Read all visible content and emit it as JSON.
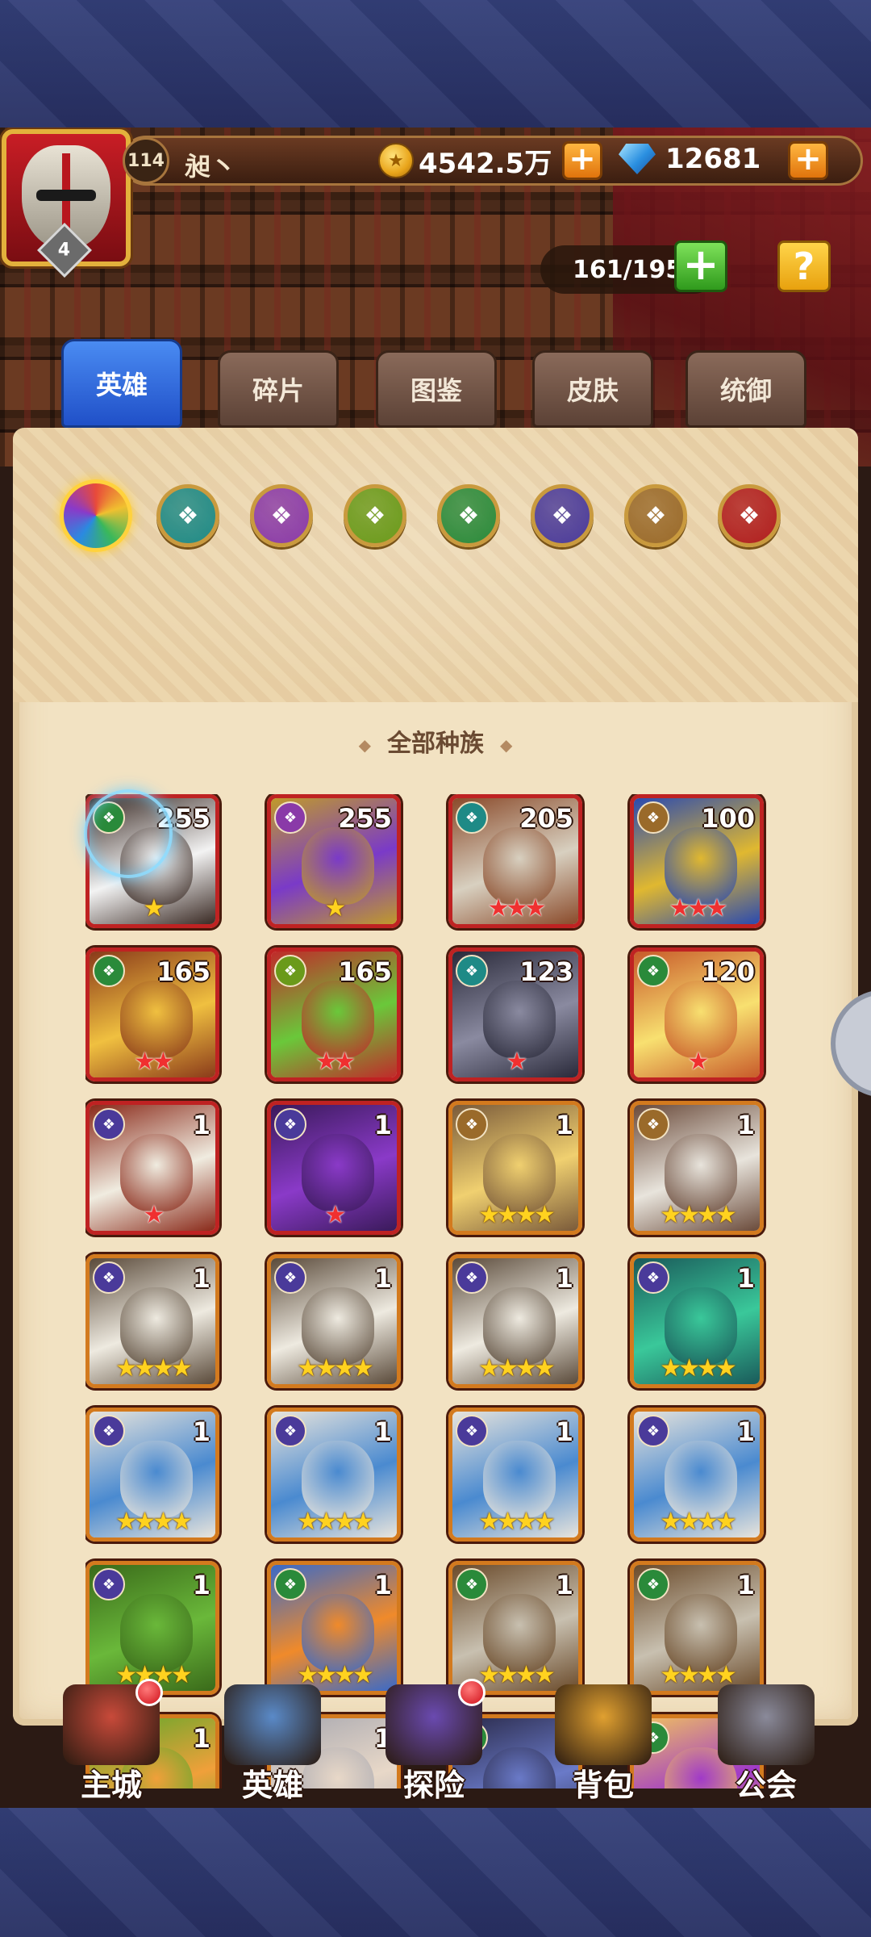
{
  "player": {
    "level": "114",
    "name": "昶丶",
    "vip": "4"
  },
  "currency": {
    "gold": "4542.5万",
    "gems": "12681"
  },
  "hero_capacity": "161/195",
  "buttons": {
    "plus": "+",
    "help": "?"
  },
  "tabs": [
    {
      "label": "英雄",
      "active": true
    },
    {
      "label": "碎片",
      "active": false
    },
    {
      "label": "图鉴",
      "active": false
    },
    {
      "label": "皮肤",
      "active": false
    },
    {
      "label": "统御",
      "active": false
    }
  ],
  "races": [
    {
      "name": "all",
      "icon": "rainbow-swirl-icon",
      "color": "#e84a3a",
      "selected": true
    },
    {
      "name": "sea",
      "icon": "trident-icon",
      "color": "#1e8a86"
    },
    {
      "name": "mystic",
      "icon": "violet-eye-icon",
      "color": "#8a3aa8"
    },
    {
      "name": "forest-eye",
      "icon": "green-eye-icon",
      "color": "#6a9a1a"
    },
    {
      "name": "nature",
      "icon": "leaf-icon",
      "color": "#2a8a3a"
    },
    {
      "name": "undead",
      "icon": "skull-wings-icon",
      "color": "#4a3a9a"
    },
    {
      "name": "light",
      "icon": "sun-wheel-icon",
      "color": "#9a6a2a"
    },
    {
      "name": "dark",
      "icon": "demon-icon",
      "color": "#b01e1e"
    }
  ],
  "race_filter_title": "全部种族",
  "heroes": [
    {
      "level": "255",
      "stars": 1,
      "star_color": "gold",
      "frame": "red",
      "race_color": "#2a8a3a",
      "palette": [
        "#f3f3f3",
        "#3a2a24"
      ]
    },
    {
      "level": "255",
      "stars": 1,
      "star_color": "gold",
      "frame": "red",
      "race_color": "#8a3aa8",
      "palette": [
        "#7a3ac8",
        "#c09a2a"
      ]
    },
    {
      "level": "205",
      "stars": 3,
      "star_color": "red",
      "frame": "red",
      "race_color": "#1e8a86",
      "palette": [
        "#d8d0c0",
        "#8a4a2a"
      ]
    },
    {
      "level": "100",
      "stars": 3,
      "star_color": "red",
      "frame": "red",
      "race_color": "#9a6a2a",
      "palette": [
        "#e0b830",
        "#2a4ab0"
      ]
    },
    {
      "level": "165",
      "stars": 2,
      "star_color": "red",
      "frame": "red",
      "race_color": "#2a8a3a",
      "palette": [
        "#f0c040",
        "#8a3a1a"
      ]
    },
    {
      "level": "165",
      "stars": 2,
      "star_color": "red",
      "frame": "red",
      "race_color": "#6a9a1a",
      "palette": [
        "#6ac83a",
        "#c02a2a"
      ]
    },
    {
      "level": "123",
      "stars": 1,
      "star_color": "red",
      "frame": "red",
      "race_color": "#1e8a86",
      "palette": [
        "#8a8aa0",
        "#2a2a3a"
      ]
    },
    {
      "level": "120",
      "stars": 1,
      "star_color": "red",
      "frame": "red",
      "race_color": "#2a8a3a",
      "palette": [
        "#f8e070",
        "#c85a2a"
      ]
    },
    {
      "level": "1",
      "stars": 1,
      "star_color": "red",
      "frame": "red",
      "race_color": "#4a3a9a",
      "palette": [
        "#f0ece0",
        "#8a2a1a"
      ]
    },
    {
      "level": "1",
      "stars": 1,
      "star_color": "red",
      "frame": "red",
      "race_color": "#4a3a9a",
      "palette": [
        "#8a3ac8",
        "#3a1a5a"
      ]
    },
    {
      "level": "1",
      "stars": 4,
      "star_color": "gold",
      "frame": "orange",
      "race_color": "#9a6a2a",
      "palette": [
        "#f0d070",
        "#7a5a3a"
      ]
    },
    {
      "level": "1",
      "stars": 4,
      "star_color": "gold",
      "frame": "orange",
      "race_color": "#9a6a2a",
      "palette": [
        "#e8e4dc",
        "#6a4a3a"
      ]
    },
    {
      "level": "1",
      "stars": 4,
      "star_color": "gold",
      "frame": "orange",
      "race_color": "#4a3a9a",
      "palette": [
        "#eeeae0",
        "#5a4a3a"
      ]
    },
    {
      "level": "1",
      "stars": 4,
      "star_color": "gold",
      "frame": "orange",
      "race_color": "#4a3a9a",
      "palette": [
        "#eeeae0",
        "#5a4a3a"
      ]
    },
    {
      "level": "1",
      "stars": 4,
      "star_color": "gold",
      "frame": "orange",
      "race_color": "#4a3a9a",
      "palette": [
        "#eeeae0",
        "#5a4a3a"
      ]
    },
    {
      "level": "1",
      "stars": 4,
      "star_color": "gold",
      "frame": "orange",
      "race_color": "#4a3a9a",
      "palette": [
        "#3ac89a",
        "#1a5a5a"
      ]
    },
    {
      "level": "1",
      "stars": 4,
      "star_color": "gold",
      "frame": "orange",
      "race_color": "#4a3a9a",
      "palette": [
        "#4a8ad0",
        "#e8e4dc"
      ]
    },
    {
      "level": "1",
      "stars": 4,
      "star_color": "gold",
      "frame": "orange",
      "race_color": "#4a3a9a",
      "palette": [
        "#4a8ad0",
        "#e8e4dc"
      ]
    },
    {
      "level": "1",
      "stars": 4,
      "star_color": "gold",
      "frame": "orange",
      "race_color": "#4a3a9a",
      "palette": [
        "#4a8ad0",
        "#e8e4dc"
      ]
    },
    {
      "level": "1",
      "stars": 4,
      "star_color": "gold",
      "frame": "orange",
      "race_color": "#4a3a9a",
      "palette": [
        "#4a8ad0",
        "#e8e4dc"
      ]
    },
    {
      "level": "1",
      "stars": 4,
      "star_color": "gold",
      "frame": "orange",
      "race_color": "#4a3a9a",
      "palette": [
        "#6ab83a",
        "#3a6a1a"
      ]
    },
    {
      "level": "1",
      "stars": 4,
      "star_color": "gold",
      "frame": "orange",
      "race_color": "#2a8a3a",
      "palette": [
        "#f08a2a",
        "#3a6ac8"
      ]
    },
    {
      "level": "1",
      "stars": 4,
      "star_color": "gold",
      "frame": "orange",
      "race_color": "#2a8a3a",
      "palette": [
        "#c8c0b0",
        "#6a4a2a"
      ]
    },
    {
      "level": "1",
      "stars": 4,
      "star_color": "gold",
      "frame": "orange",
      "race_color": "#2a8a3a",
      "palette": [
        "#c8c0b0",
        "#6a4a2a"
      ]
    },
    {
      "level": "1",
      "stars": 0,
      "star_color": "gold",
      "frame": "orange",
      "race_color": "#2a8a3a",
      "palette": [
        "#f0a03a",
        "#5aa82a"
      ]
    },
    {
      "level": "1",
      "stars": 0,
      "star_color": "gold",
      "frame": "orange",
      "race_color": "#2a8a3a",
      "palette": [
        "#e8d8c8",
        "#a8a8b0"
      ]
    },
    {
      "level": "1",
      "stars": 0,
      "star_color": "gold",
      "frame": "orange",
      "race_color": "#2a8a3a",
      "palette": [
        "#6a7ac8",
        "#2a2a4a"
      ]
    },
    {
      "level": "1",
      "stars": 0,
      "star_color": "gold",
      "frame": "orange",
      "race_color": "#2a8a3a",
      "palette": [
        "#a03ac8",
        "#f0c060"
      ]
    }
  ],
  "bottom_nav": [
    {
      "label": "主城",
      "icon": "castle-icon",
      "color": "#c84a3a",
      "badge": true
    },
    {
      "label": "英雄",
      "icon": "hero-portrait-icon",
      "color": "#5a8ac8",
      "badge": false
    },
    {
      "label": "探险",
      "icon": "portal-icon",
      "color": "#6a4ab0",
      "badge": true
    },
    {
      "label": "背包",
      "icon": "backpack-icon",
      "color": "#e0a030",
      "badge": false
    },
    {
      "label": "公会",
      "icon": "guild-tower-icon",
      "color": "#8a8a9a",
      "badge": false
    }
  ]
}
